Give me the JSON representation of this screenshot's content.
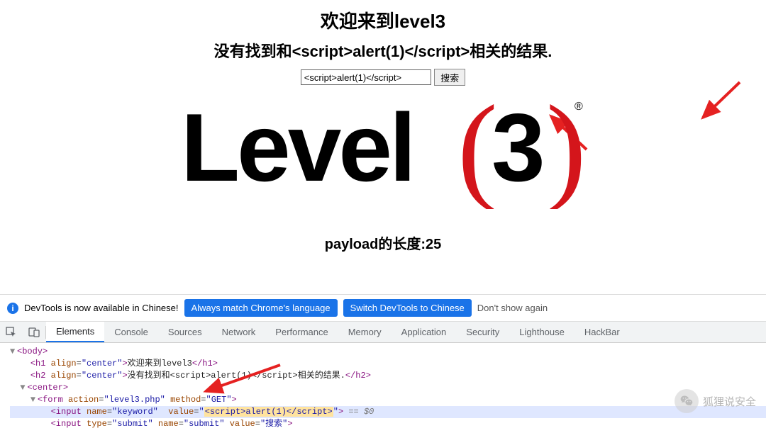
{
  "page": {
    "title_prefix": "欢迎来到",
    "title_level": "level3",
    "subtitle_prefix": "没有找到和",
    "subtitle_payload": "<script>alert(1)</script>",
    "subtitle_suffix": "相关的结果.",
    "search_value": "<script>alert(1)</script>",
    "search_button": "搜索",
    "payload_label": "payload的长度:",
    "payload_len": "25"
  },
  "logo": {
    "text_level": "Level",
    "text_paren_open": "(",
    "text_num": "3",
    "text_paren_close": ")",
    "registered": "®"
  },
  "devtools": {
    "notice": "DevTools is now available in Chinese!",
    "btn_always": "Always match Chrome's language",
    "btn_switch": "Switch DevTools to Chinese",
    "dont_show": "Don't show again",
    "tabs": [
      "Elements",
      "Console",
      "Sources",
      "Network",
      "Performance",
      "Memory",
      "Application",
      "Security",
      "Lighthouse",
      "HackBar"
    ],
    "active_tab": "Elements"
  },
  "dom": {
    "line1": {
      "open": "<body>"
    },
    "line2": {
      "open": "<h1 ",
      "attr": "align",
      "val": "center",
      "text": "欢迎来到level3",
      "close": "</h1>"
    },
    "line3": {
      "open": "<h2 ",
      "attr": "align",
      "val": "center",
      "text": "没有找到和<script>alert(1)</script>相关的结果.",
      "close": "</h2>"
    },
    "line4": {
      "open": "<center>"
    },
    "line5": {
      "open": "<form ",
      "a1n": "action",
      "a1v": "level3.php",
      "a2n": "method",
      "a2v": "GET",
      "close": ">"
    },
    "line6": {
      "open": "<input ",
      "a1n": "name",
      "a1v": "keyword",
      "a2n": "value",
      "a2v": "<script>alert(1)</script>",
      "close": ">",
      "eq": " == $0"
    },
    "line7": {
      "open": "<input ",
      "a1n": "type",
      "a1v": "submit",
      "a2n": "name",
      "a2v": "submit",
      "a3n": "value",
      "a3v": "搜索",
      "close": ">"
    }
  },
  "watermark": {
    "text": "狐狸说安全"
  }
}
